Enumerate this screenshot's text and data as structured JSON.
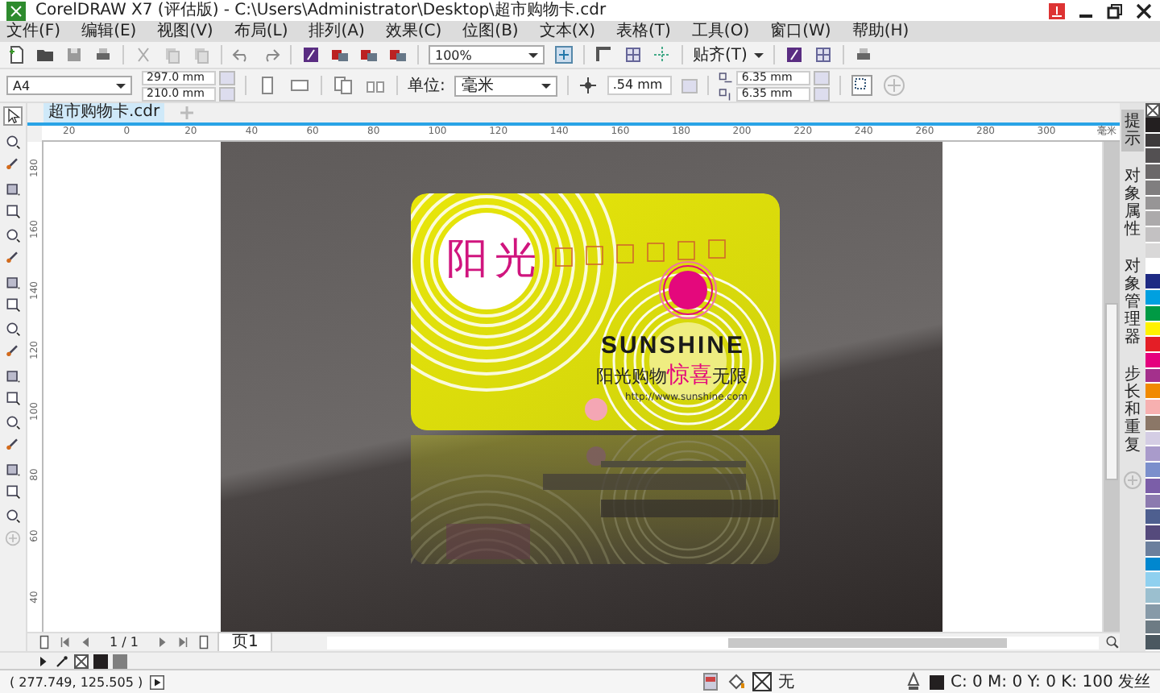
{
  "window": {
    "title": "CorelDRAW X7 (评估版) - C:\\Users\\Administrator\\Desktop\\超市购物卡.cdr"
  },
  "menu": [
    "文件(F)",
    "编辑(E)",
    "视图(V)",
    "布局(L)",
    "排列(A)",
    "效果(C)",
    "位图(B)",
    "文本(X)",
    "表格(T)",
    "工具(O)",
    "窗口(W)",
    "帮助(H)"
  ],
  "toolbar": {
    "zoom": "100%",
    "snap": "贴齐(T)"
  },
  "property_bar": {
    "page_size": "A4",
    "width": "297.0 mm",
    "height": "210.0 mm",
    "units_label": "单位:",
    "units": "毫米",
    "nudge": ".54 mm",
    "dup_x": "6.35 mm",
    "dup_y": "6.35 mm"
  },
  "document_tab": {
    "label": "超市购物卡.cdr",
    "selected": true
  },
  "ruler": {
    "h_ticks": [
      "20",
      "0",
      "20",
      "40",
      "60",
      "80",
      "100",
      "120",
      "140",
      "160",
      "180",
      "200",
      "220",
      "240",
      "260",
      "280",
      "300"
    ],
    "unit": "毫米",
    "v_ticks": [
      "180",
      "160",
      "140",
      "120",
      "100",
      "80",
      "60",
      "40"
    ]
  },
  "card": {
    "title": "阳光",
    "brand": "SUNSHINE",
    "slogan": "阳光购物**惊喜**无限",
    "url": "http://www.sunshine.com"
  },
  "dockers": [
    {
      "label": "提示",
      "selected": true
    },
    {
      "label": "对象属性",
      "selected": false
    },
    {
      "label": "对象管理器",
      "selected": false
    },
    {
      "label": "步长和重复",
      "selected": false
    }
  ],
  "page_nav": {
    "counter": "1 / 1",
    "page_tab": "页1"
  },
  "palette": [
    {
      "color": "#231f20"
    },
    {
      "color": "#3d3a3b"
    },
    {
      "color": "#535052"
    },
    {
      "color": "#6b6869"
    },
    {
      "color": "#807e7f"
    },
    {
      "color": "#979596"
    },
    {
      "color": "#acaaab"
    },
    {
      "color": "#c3c1c2"
    },
    {
      "color": "#d9d8d8"
    },
    {
      "color": "#ffffff"
    },
    {
      "color": "#1e2a84"
    },
    {
      "color": "#00a0e0"
    },
    {
      "color": "#009a44"
    },
    {
      "color": "#fff200"
    },
    {
      "color": "#e41e26"
    },
    {
      "color": "#e5007e"
    },
    {
      "color": "#a4308c"
    },
    {
      "color": "#f18a00"
    },
    {
      "color": "#f7b0b0"
    },
    {
      "color": "#8b7767"
    },
    {
      "color": "#d4cde4"
    },
    {
      "color": "#a99bcb"
    },
    {
      "color": "#7b8fcc"
    },
    {
      "color": "#7b5ea8"
    },
    {
      "color": "#8c7aaf"
    },
    {
      "color": "#4e5f8f"
    },
    {
      "color": "#554a7c"
    },
    {
      "color": "#6b7f9d"
    },
    {
      "color": "#0087cf"
    },
    {
      "color": "#8fd0ef"
    },
    {
      "color": "#9bbfcf"
    },
    {
      "color": "#879aa8"
    },
    {
      "color": "#6d7b84"
    },
    {
      "color": "#4b5860"
    }
  ],
  "document_palette": [
    {
      "color": "#231f20"
    },
    {
      "color": "#7f7f7f"
    }
  ],
  "status_bar": {
    "coordinates": "( 277.749, 125.505 )",
    "fill": "无",
    "outline": "C: 0 M: 0 Y: 0 K: 100 发丝"
  }
}
